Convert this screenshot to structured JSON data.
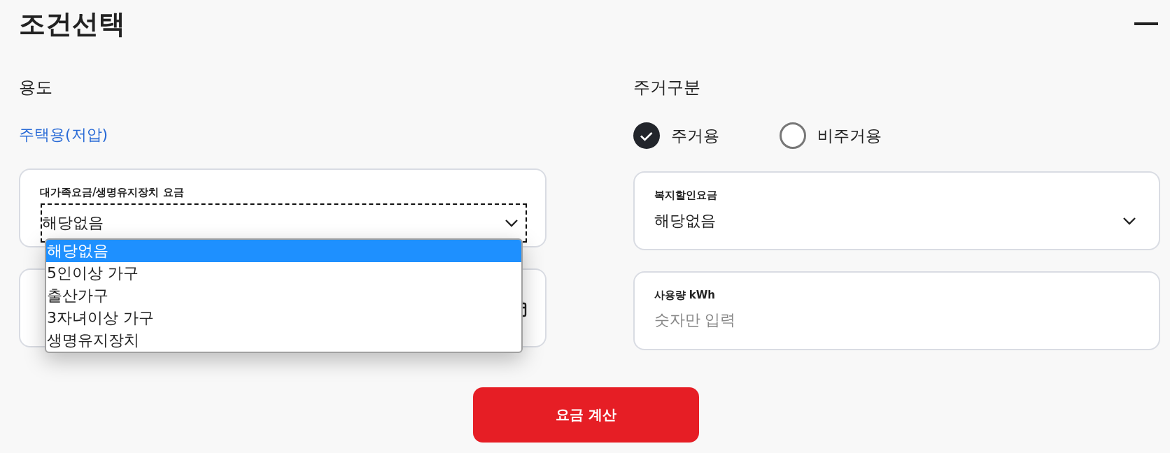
{
  "title": "조건선택",
  "usage": {
    "label": "용도",
    "value": "주택용(저압)"
  },
  "family_select": {
    "label": "대가족요금/생명유지장치 요금",
    "value": "해당없음",
    "expanded": true,
    "options": [
      {
        "label": "해당없음",
        "selected": true
      },
      {
        "label": "5인이상 가구",
        "selected": false
      },
      {
        "label": "출산가구",
        "selected": false
      },
      {
        "label": "3자녀이상 가구",
        "selected": false
      },
      {
        "label": "생명유지장치",
        "selected": false
      }
    ]
  },
  "residence": {
    "label": "주거구분",
    "options": [
      {
        "label": "주거용",
        "selected": true
      },
      {
        "label": "비주거용",
        "selected": false
      }
    ]
  },
  "welfare_select": {
    "label": "복지할인요금",
    "value": "해당없음"
  },
  "usage_input": {
    "label": "사용량 kWh",
    "placeholder": "숫자만 입력"
  },
  "calculate_button": "요금 계산"
}
